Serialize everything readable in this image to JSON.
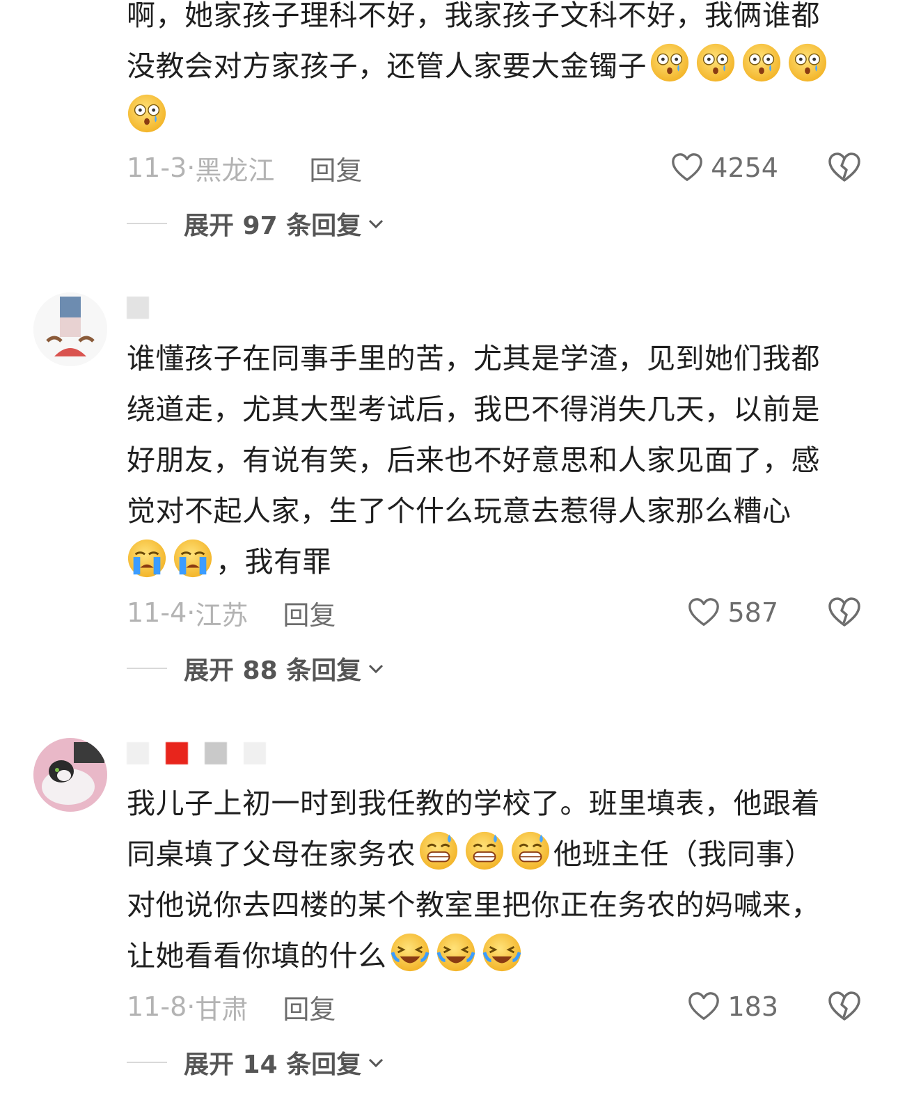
{
  "comments": [
    {
      "text_lines": [
        "啊，她家孩子理科不好，我家孩子文科不好，我俩谁都",
        "没教会对方家孩子，还管人家要大金镯子"
      ],
      "date": "11-3",
      "location": "黑龙江",
      "reply_label": "回复",
      "likes": "4254",
      "expand_label": "展开 97 条回复"
    },
    {
      "text_lines": [
        "谁懂孩子在同事手里的苦，尤其是学渣，见到她们我都",
        "绕道走，尤其大型考试后，我巴不得消失几天，以前是",
        "好朋友，有说有笑，后来也不好意思和人家见面了，感",
        "觉对不起人家，生了个什么玩意去惹得人家那么糟心"
      ],
      "tail_text": "，我有罪",
      "date": "11-4",
      "location": "江苏",
      "reply_label": "回复",
      "likes": "587",
      "expand_label": "展开 88 条回复"
    },
    {
      "text_lines": [
        "我儿子上初一时到我任教的学校了。班里填表，他跟着",
        "同桌填了父母在家务农",
        "他班主任（我同事）",
        "对他说你去四楼的某个教室里把你正在务农的妈喊来，",
        "让她看看你填的什么"
      ],
      "date": "11-8",
      "location": "甘肃",
      "reply_label": "回复",
      "likes": "183",
      "expand_label": "展开 14 条回复"
    }
  ],
  "icons": {
    "like": "heart-outline-icon",
    "dislike": "broken-heart-icon",
    "expand": "chevron-down-icon",
    "emoji_stunned": "stunned-emoji-icon",
    "emoji_crying": "crying-emoji-icon",
    "emoji_sweat": "sweat-grin-emoji-icon",
    "emoji_laugh": "rolling-laugh-emoji-icon"
  },
  "colors": {
    "text": "#1f1f1f",
    "meta": "#b3b3b3",
    "action": "#6d6d6d",
    "emoji": "#f5c542"
  }
}
